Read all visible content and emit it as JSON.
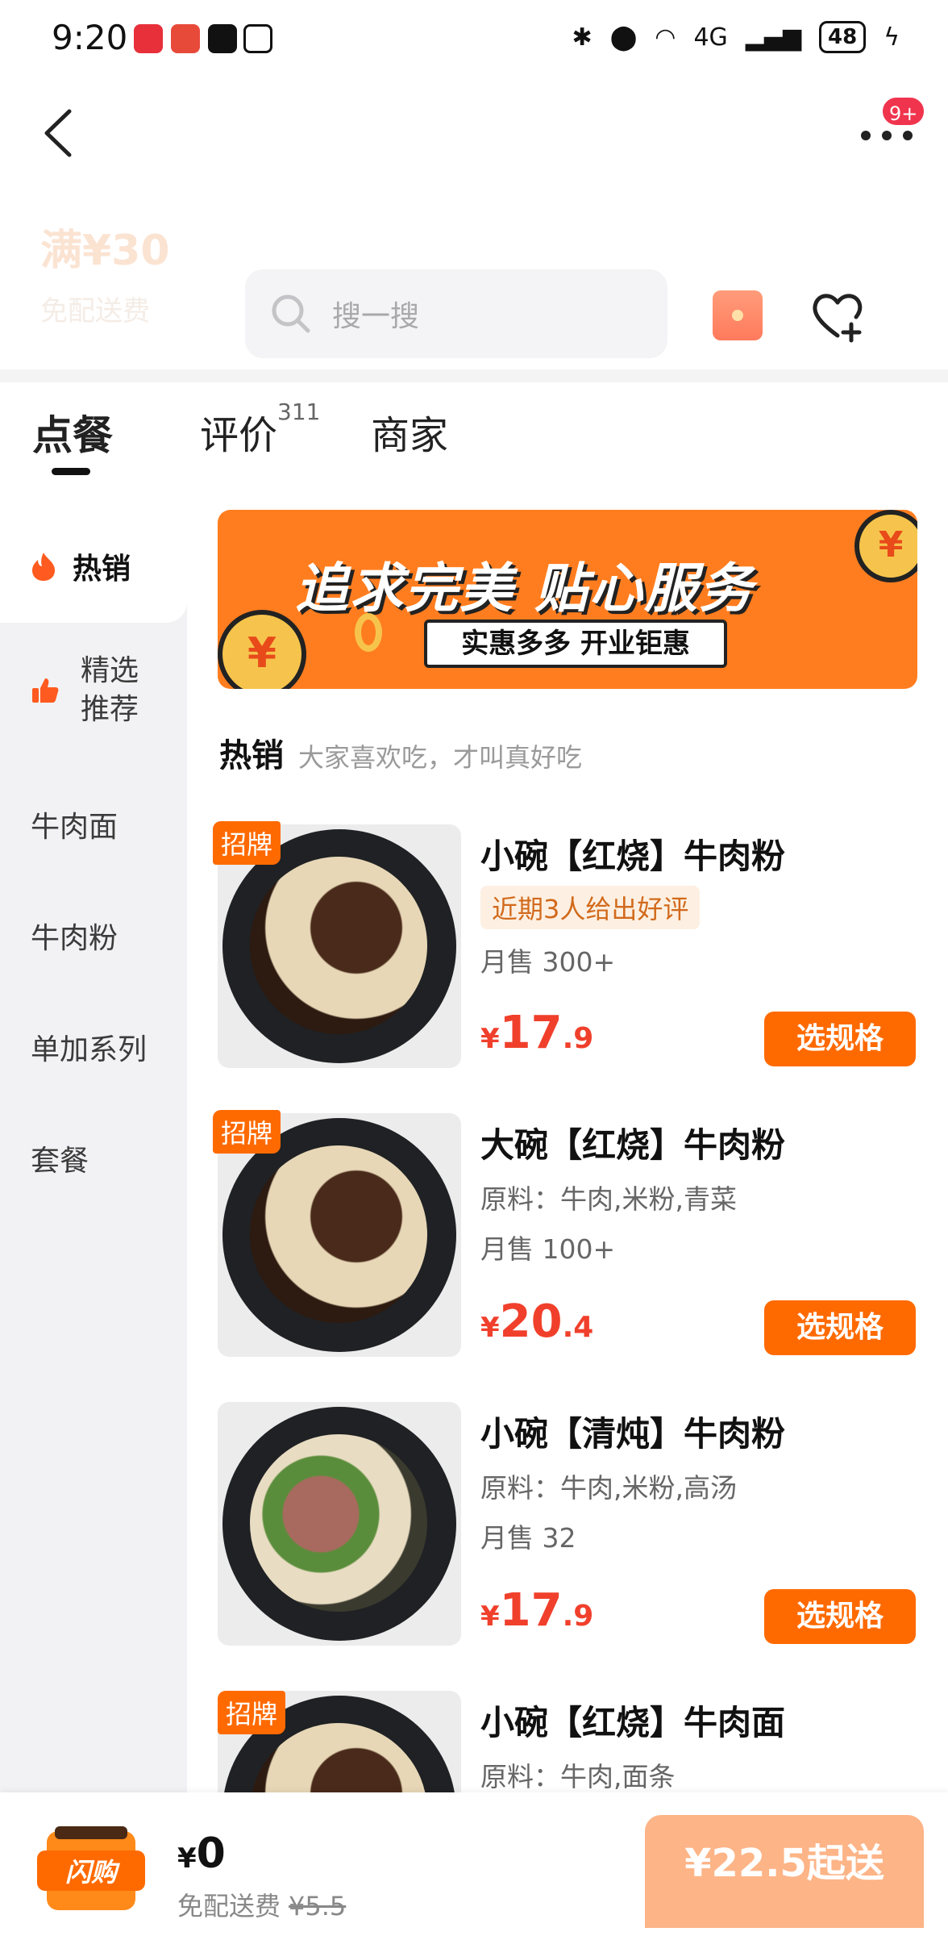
{
  "status_bar": {
    "time": "9:20",
    "network": "4G",
    "battery": "48"
  },
  "top_nav": {
    "more_badge": "9+"
  },
  "store_header": {
    "min_order": "满¥30",
    "delivery_free": "免配送费"
  },
  "search": {
    "placeholder": "搜一搜"
  },
  "tabs": [
    {
      "label": "点餐"
    },
    {
      "label": "评价",
      "count": "311"
    },
    {
      "label": "商家"
    }
  ],
  "sidebar": {
    "items": [
      {
        "label": "热销"
      },
      {
        "label": "精选推荐"
      },
      {
        "label": "牛肉面"
      },
      {
        "label": "牛肉粉"
      },
      {
        "label": "单加系列"
      },
      {
        "label": "套餐"
      }
    ]
  },
  "banner": {
    "title": "追求完美 贴心服务",
    "subtitle": "实惠多多 开业钜惠",
    "coin_symbol": "¥"
  },
  "section": {
    "title": "热销",
    "subtitle": "大家喜欢吃，才叫真好吃"
  },
  "products": [
    {
      "tag": "招牌",
      "name": "小碗【红烧】牛肉粉",
      "badge": "近期3人给出好评",
      "sales": "月售 300+",
      "price_currency": "¥",
      "price_int": "17",
      "price_dec": ".9",
      "button": "选规格"
    },
    {
      "tag": "招牌",
      "name": "大碗【红烧】牛肉粉",
      "ingredients": "原料：牛肉,米粉,青菜",
      "sales": "月售 100+",
      "price_currency": "¥",
      "price_int": "20",
      "price_dec": ".4",
      "button": "选规格"
    },
    {
      "name": "小碗【清炖】牛肉粉",
      "ingredients": "原料：牛肉,米粉,高汤",
      "sales": "月售 32",
      "price_currency": "¥",
      "price_int": "17",
      "price_dec": ".9",
      "button": "选规格"
    },
    {
      "tag": "招牌",
      "name": "小碗【红烧】牛肉面",
      "ingredients": "原料：牛肉,面条"
    }
  ],
  "cart": {
    "icon_label": "闪购",
    "currency": "¥",
    "amount": "0",
    "free_delivery": "免配送费",
    "old_fee": "¥5.5",
    "checkout": "¥22.5起送"
  },
  "colors": {
    "accent": "#ff6a00",
    "price": "#f0402c",
    "badge_bg": "#fdf0e2",
    "checkout_disabled": "#fdb487"
  }
}
